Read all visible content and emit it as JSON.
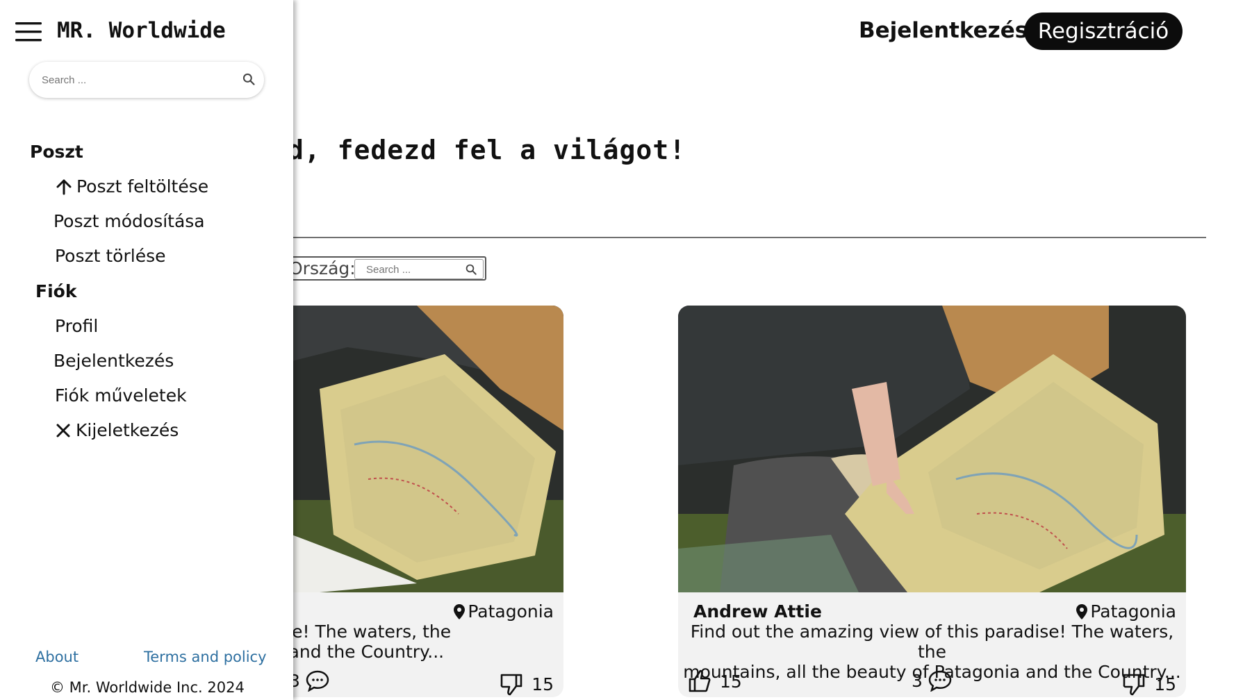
{
  "header": {
    "login_label": "Bejelentkezés",
    "register_label": "Regisztráció"
  },
  "hero": {
    "title_visible": "d, fedezd fel a világot!"
  },
  "filter": {
    "label": "Ország:",
    "search_placeholder": "Search ..."
  },
  "cards": [
    {
      "author": "",
      "location": "Patagonia",
      "description_line1": "of this paradise! The waters, the",
      "description_line2": "of Patagonia and the Country...",
      "likes": "",
      "comments": "3",
      "dislikes": "15"
    },
    {
      "author": "Andrew Attie",
      "location": "Patagonia",
      "description_line1": "Find out the amazing view of this paradise! The waters, the",
      "description_line2": "mountains, all the beauty of Patagonia and the Country...",
      "likes": "15",
      "comments": "3",
      "dislikes": "15"
    }
  ],
  "sidebar": {
    "brand": "MR. Worldwide",
    "search_placeholder": "Search ...",
    "sections": [
      {
        "title": "Poszt",
        "items": [
          {
            "label": "Poszt feltöltése",
            "icon": "arrow-up-icon"
          },
          {
            "label": "Poszt módosítása"
          },
          {
            "label": "Poszt törlése"
          }
        ]
      },
      {
        "title": "Fiók",
        "items": [
          {
            "label": "Profil"
          },
          {
            "label": "Bejelentkezés"
          },
          {
            "label": "Fiók műveletek"
          },
          {
            "label": "Kijeletkezés",
            "icon": "close-icon"
          }
        ]
      }
    ],
    "footer": {
      "about": "About",
      "terms": "Terms and policy",
      "copyright": "© Mr. Worldwide Inc. 2024"
    }
  },
  "colors": {
    "primary_button": "#0c0c0c",
    "link": "#2d6fa0",
    "card_background": "#f2f2f2"
  }
}
